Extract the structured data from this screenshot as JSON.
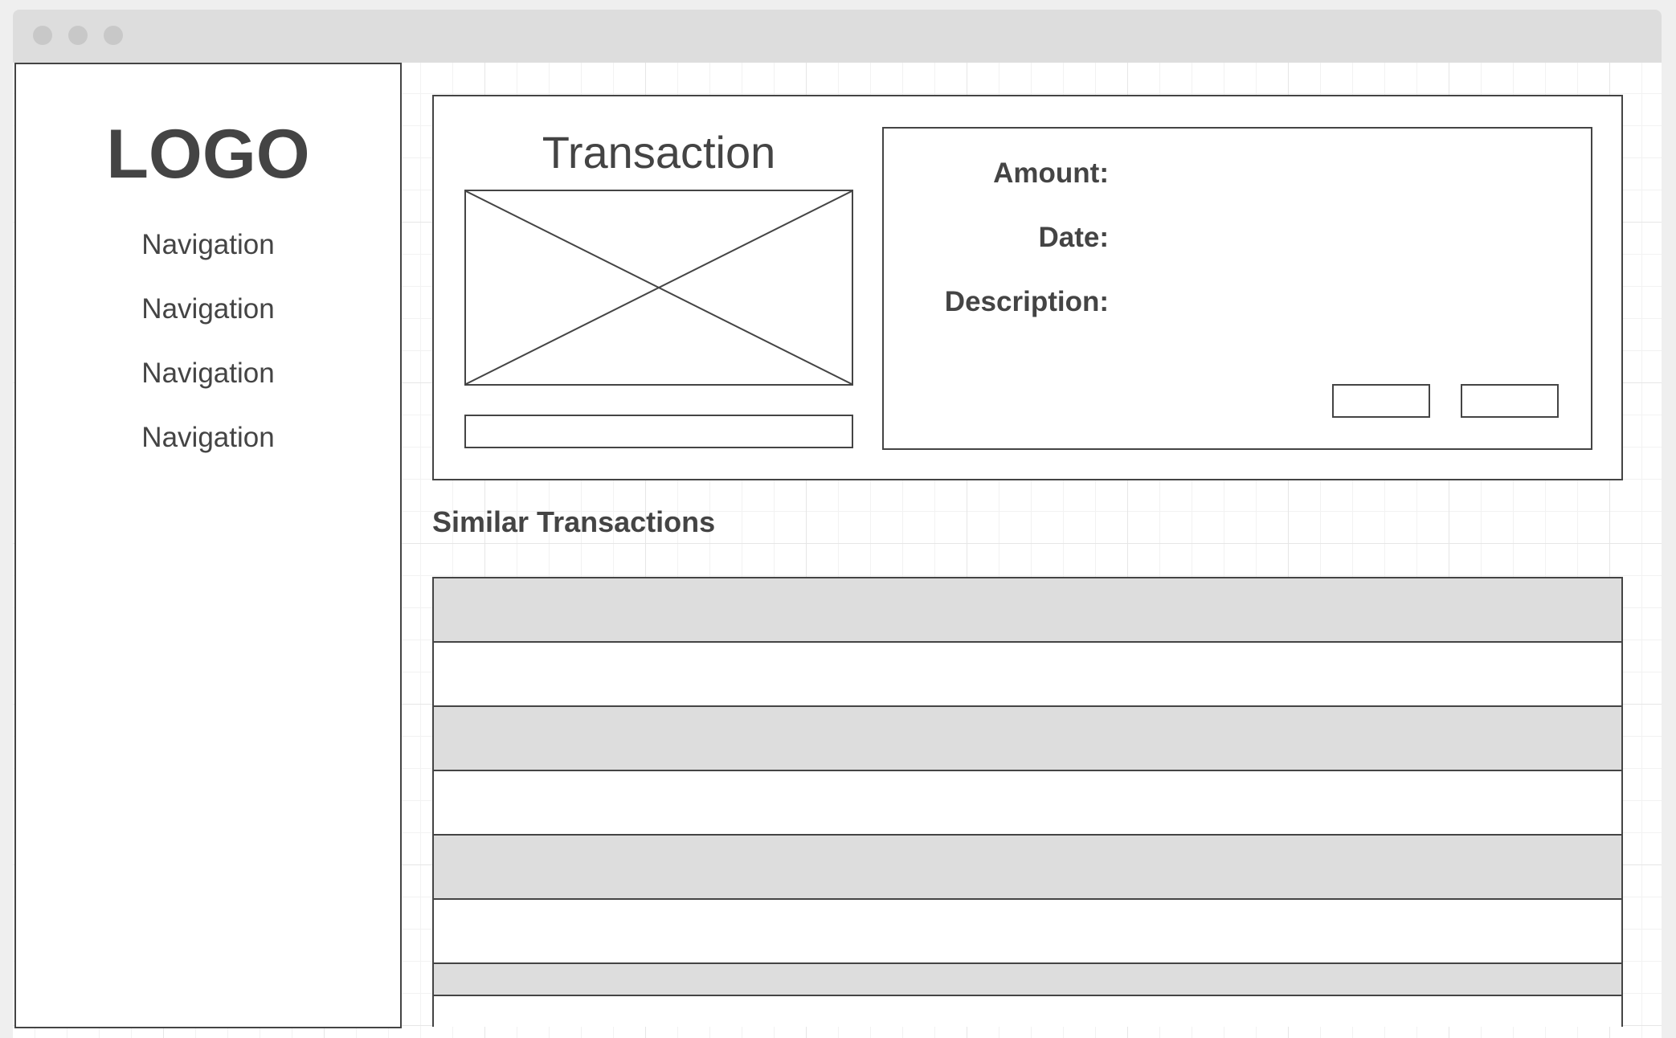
{
  "sidebar": {
    "logo": "LOGO",
    "items": [
      {
        "label": "Navigation"
      },
      {
        "label": "Navigation"
      },
      {
        "label": "Navigation"
      },
      {
        "label": "Navigation"
      }
    ]
  },
  "transaction": {
    "title": "Transaction",
    "fields": {
      "amount_label": "Amount:",
      "amount_value": "",
      "date_label": "Date:",
      "date_value": "",
      "description_label": "Description:",
      "description_value": ""
    },
    "buttons": {
      "first_label": "",
      "second_label": ""
    }
  },
  "similar": {
    "title": "Similar Transactions",
    "rows": [
      {
        "shaded": true
      },
      {
        "shaded": false
      },
      {
        "shaded": true
      },
      {
        "shaded": false
      },
      {
        "shaded": true
      },
      {
        "shaded": false
      },
      {
        "shaded": true
      },
      {
        "shaded": false
      }
    ]
  },
  "colors": {
    "stroke": "#444444",
    "shade": "#dddddd",
    "titlebar": "#dddddd",
    "grid": "#e6e6e6"
  }
}
